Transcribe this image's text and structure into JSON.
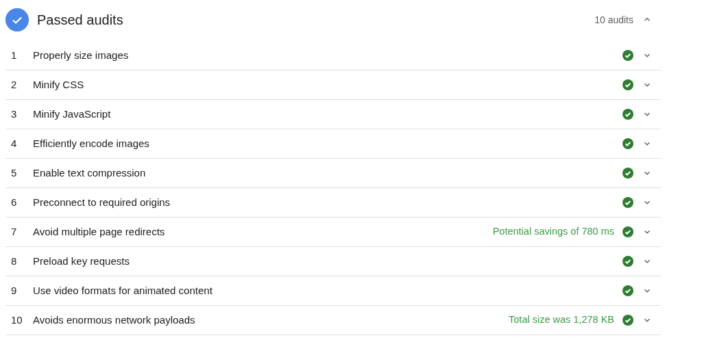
{
  "section": {
    "title": "Passed audits",
    "count": "10 audits",
    "expanded": true
  },
  "audits": [
    {
      "number": "1",
      "title": "Properly size images",
      "expanded": false
    },
    {
      "number": "2",
      "title": "Minify CSS",
      "expanded": false
    },
    {
      "number": "3",
      "title": "Minify JavaScript",
      "expanded": false
    },
    {
      "number": "4",
      "title": "Efficiently encode images",
      "expanded": false
    },
    {
      "number": "5",
      "title": "Enable text compression",
      "expanded": false
    },
    {
      "number": "6",
      "title": "Preconnect to required origins",
      "expanded": false
    },
    {
      "number": "7",
      "title": "Avoid multiple page redirects",
      "summary": "Potential savings of 780 ms",
      "expanded": false
    },
    {
      "number": "8",
      "title": "Preload key requests",
      "expanded": false
    },
    {
      "number": "9",
      "title": "Use video formats for animated content",
      "expanded": false
    },
    {
      "number": "10",
      "title": "Avoids enormous network payloads",
      "summary": "Total size was 1,278 KB",
      "expanded": false
    }
  ]
}
